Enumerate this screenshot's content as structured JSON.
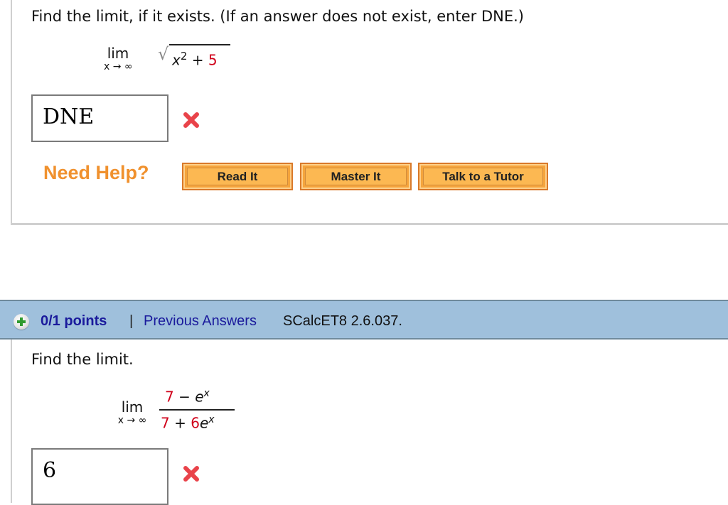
{
  "question1": {
    "prompt": "Find the limit, if it exists. (If an answer does not exist, enter DNE.)",
    "limit": {
      "word": "lim",
      "subscript": "x → ∞",
      "expression": {
        "radicand_var": "x",
        "exponent": "2",
        "operator": "+",
        "constant": "5"
      }
    },
    "answer_value": "DNE",
    "answer_status": "incorrect",
    "status_icon": "x-mark-icon",
    "need_help_label": "Need Help?",
    "help_buttons": [
      {
        "label": "Read It"
      },
      {
        "label": "Master It"
      },
      {
        "label": "Talk to a Tutor"
      }
    ]
  },
  "question2": {
    "header": {
      "expand_icon": "plus-circle-icon",
      "points": "0/1 points",
      "separator": "|",
      "previous_answers_link": "Previous Answers",
      "reference": "SCalcET8 2.6.037."
    },
    "prompt": "Find the limit.",
    "limit": {
      "word": "lim",
      "subscript": "x → ∞",
      "numerator": {
        "constant": "7",
        "operator": "−",
        "term": "e",
        "term_exp": "x"
      },
      "denominator": {
        "constant": "7",
        "operator": "+",
        "coef": "6",
        "term": "e",
        "term_exp": "x"
      }
    },
    "answer_value": "6",
    "answer_status": "incorrect",
    "status_icon": "x-mark-icon"
  },
  "colors": {
    "need_help": "#f0912e",
    "button_fill": "#f5a43c",
    "header_bg": "#9fc0dc",
    "link": "#1a1a9c",
    "error_red": "#e9434a",
    "math_red": "#d0021b"
  }
}
